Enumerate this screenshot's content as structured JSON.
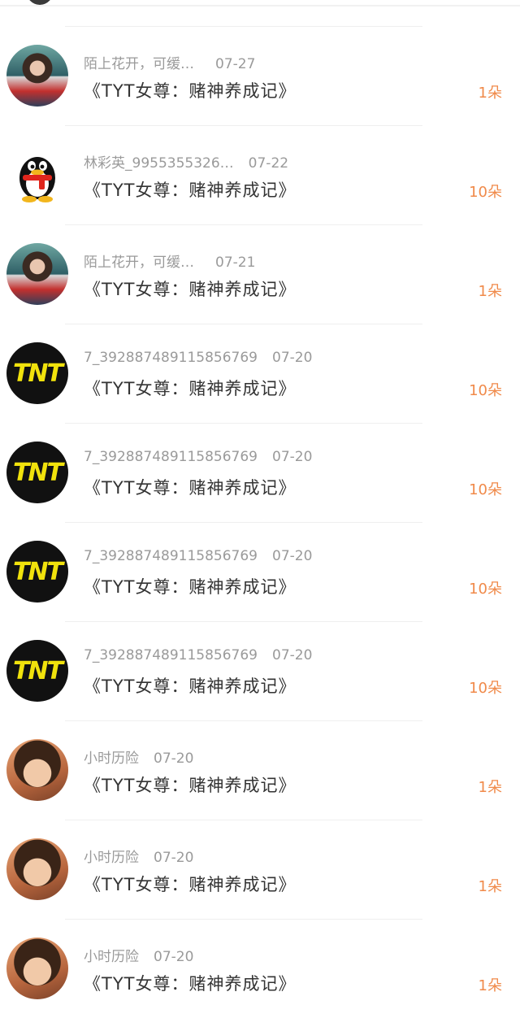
{
  "items": [
    {
      "username": "陌上花开，可缓…",
      "date": "07-27",
      "book": "《TYT女尊：赌神养成记》",
      "count": "1朵",
      "avatar": "photo-boy"
    },
    {
      "username": "林彩英_9955355326…",
      "date": "07-22",
      "book": "《TYT女尊：赌神养成记》",
      "count": "10朵",
      "avatar": "qq-penguin"
    },
    {
      "username": "陌上花开，可缓…",
      "date": "07-21",
      "book": "《TYT女尊：赌神养成记》",
      "count": "1朵",
      "avatar": "photo-boy"
    },
    {
      "username": "7_392887489115856769",
      "date": "07-20",
      "book": "《TYT女尊：赌神养成记》",
      "count": "10朵",
      "avatar": "tnt-logo"
    },
    {
      "username": "7_392887489115856769",
      "date": "07-20",
      "book": "《TYT女尊：赌神养成记》",
      "count": "10朵",
      "avatar": "tnt-logo"
    },
    {
      "username": "7_392887489115856769",
      "date": "07-20",
      "book": "《TYT女尊：赌神养成记》",
      "count": "10朵",
      "avatar": "tnt-logo"
    },
    {
      "username": "7_392887489115856769",
      "date": "07-20",
      "book": "《TYT女尊：赌神养成记》",
      "count": "10朵",
      "avatar": "tnt-logo"
    },
    {
      "username": "小时历险",
      "date": "07-20",
      "book": "《TYT女尊：赌神养成记》",
      "count": "1朵",
      "avatar": "photo-girl"
    },
    {
      "username": "小时历险",
      "date": "07-20",
      "book": "《TYT女尊：赌神养成记》",
      "count": "1朵",
      "avatar": "photo-girl"
    },
    {
      "username": "小时历险",
      "date": "07-20",
      "book": "《TYT女尊：赌神养成记》",
      "count": "1朵",
      "avatar": "photo-girl"
    }
  ],
  "avatar_logo_text": "TNT",
  "colors": {
    "count": "#f08a4a",
    "meta": "#9a9a9a",
    "title": "#333333"
  }
}
